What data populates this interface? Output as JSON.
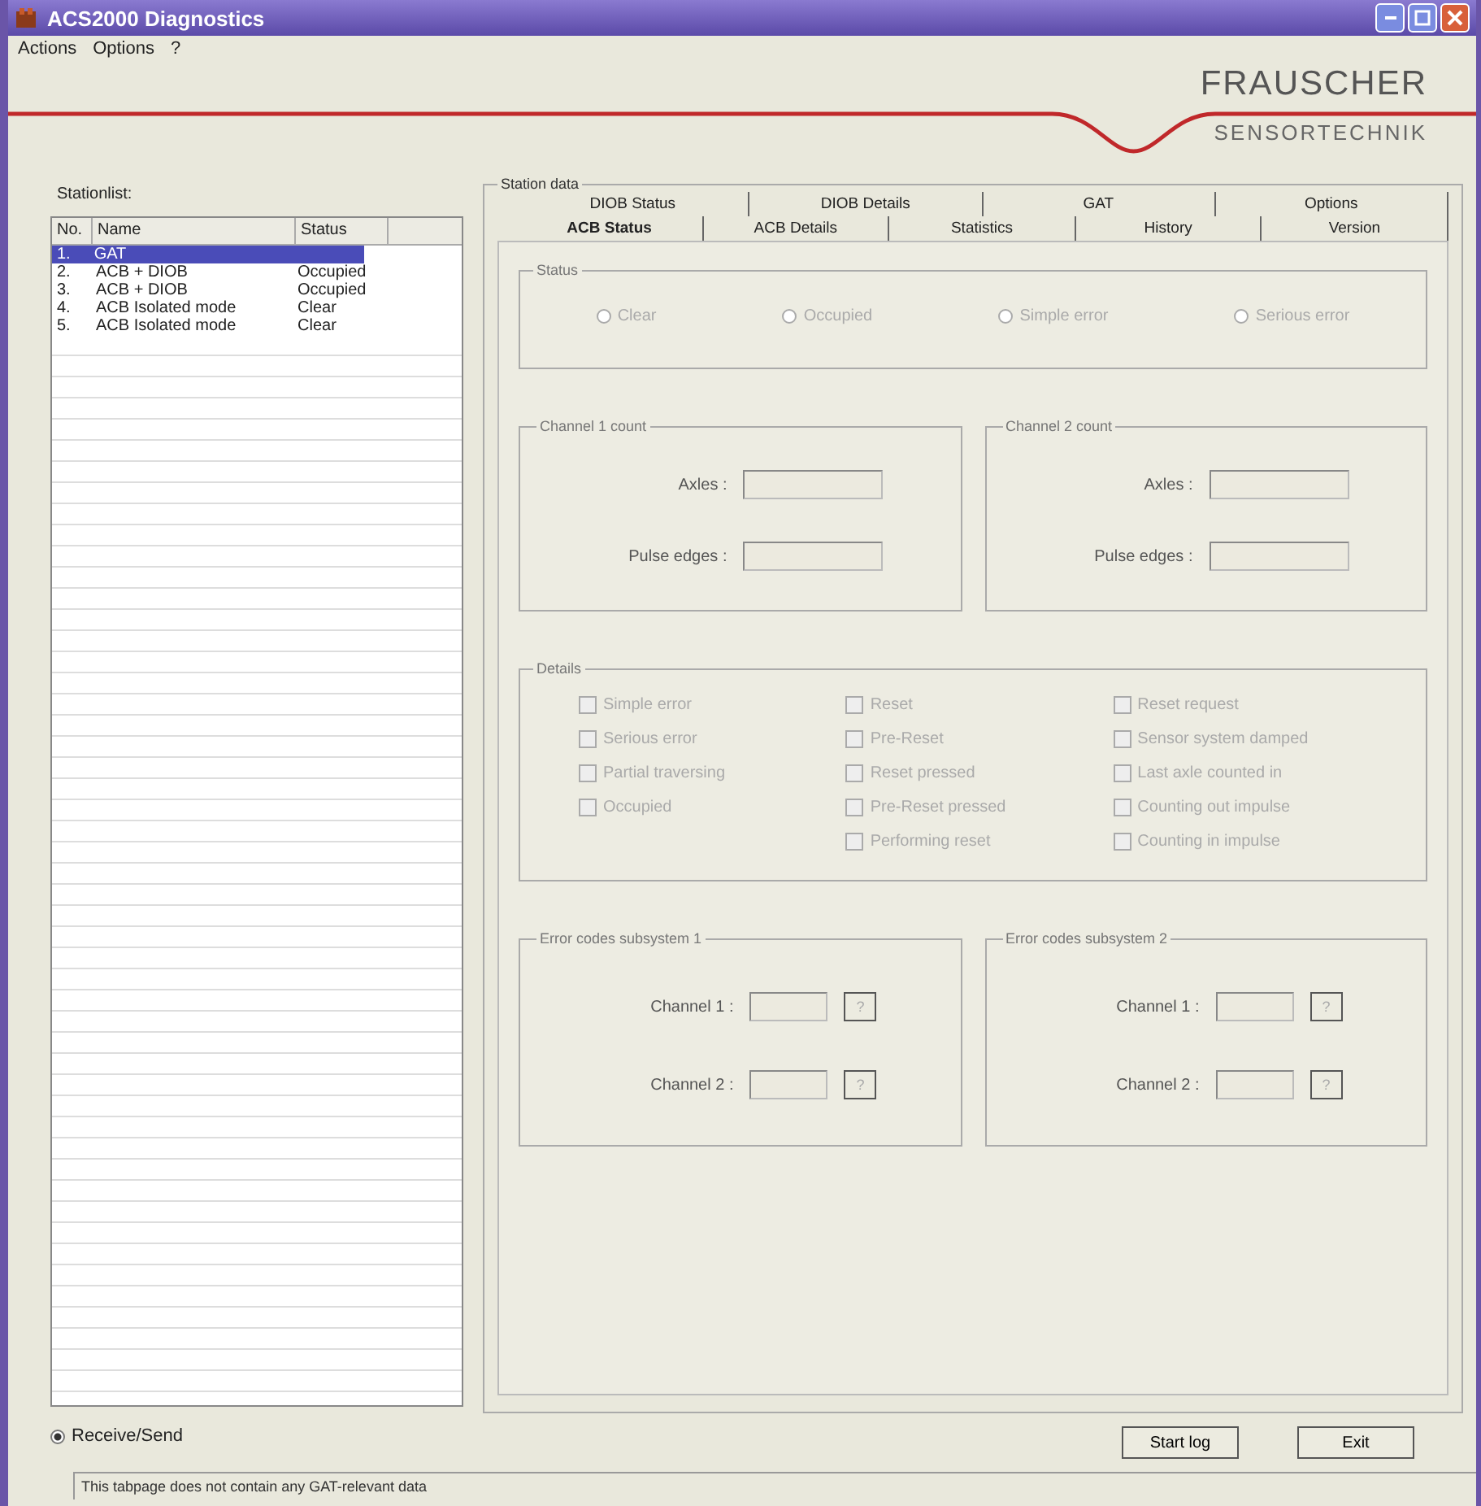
{
  "window": {
    "title": "ACS2000 Diagnostics"
  },
  "menu": [
    "Actions",
    "Options",
    "?"
  ],
  "logo": {
    "line1": "FRAUSCHER",
    "line2": "SENSORTECHNIK"
  },
  "stationlist": {
    "label": "Stationlist:",
    "columns": [
      "No.",
      "Name",
      "Status"
    ],
    "rows": [
      {
        "no": "1.",
        "name": "GAT",
        "status": "",
        "selected": true
      },
      {
        "no": "2.",
        "name": "ACB + DIOB",
        "status": "Occupied",
        "selected": false
      },
      {
        "no": "3.",
        "name": "ACB + DIOB",
        "status": "Occupied",
        "selected": false
      },
      {
        "no": "4.",
        "name": "ACB Isolated mode",
        "status": "Clear",
        "selected": false
      },
      {
        "no": "5.",
        "name": "ACB Isolated mode",
        "status": "Clear",
        "selected": false
      }
    ]
  },
  "mode": {
    "label": "Receive/Send",
    "selected": true
  },
  "status_bar": "This tabpage does not contain any GAT-relevant data",
  "station_data": {
    "label": "Station data",
    "tabs_back": [
      {
        "label": "DIOB Status",
        "selected": false
      },
      {
        "label": "DIOB Details",
        "selected": false
      },
      {
        "label": "GAT",
        "selected": false
      },
      {
        "label": "Options",
        "selected": false
      }
    ],
    "tabs_front": [
      {
        "label": "ACB Status",
        "selected": true
      },
      {
        "label": "ACB Details",
        "selected": false
      },
      {
        "label": "Statistics",
        "selected": false
      },
      {
        "label": "History",
        "selected": false
      },
      {
        "label": "Version",
        "selected": false
      }
    ],
    "status": {
      "label": "Status",
      "options": [
        {
          "label": "Clear",
          "selected": false,
          "disabled": true
        },
        {
          "label": "Occupied",
          "selected": false,
          "disabled": true
        },
        {
          "label": "Simple error",
          "selected": false,
          "disabled": true
        },
        {
          "label": "Serious error",
          "selected": false,
          "disabled": true
        }
      ]
    },
    "counts": [
      {
        "label": "Channel 1 count",
        "fields": [
          {
            "label": "Axles :",
            "disabled": true
          },
          {
            "label": "Pulse edges :",
            "disabled": true
          }
        ]
      },
      {
        "label": "Channel 2 count",
        "fields": [
          {
            "label": "Axles :",
            "disabled": true
          },
          {
            "label": "Pulse edges :",
            "disabled": true
          }
        ]
      }
    ],
    "details": {
      "label": "Details",
      "columns": [
        [
          {
            "label": "Simple error",
            "checked": false,
            "disabled": true
          },
          {
            "label": "Serious error",
            "checked": false,
            "disabled": true
          },
          {
            "label": "Partial traversing",
            "checked": false,
            "disabled": true
          },
          {
            "label": "Occupied",
            "checked": false,
            "disabled": true
          }
        ],
        [
          {
            "label": "Reset",
            "checked": false,
            "disabled": true
          },
          {
            "label": "Pre-Reset",
            "checked": false,
            "disabled": true
          },
          {
            "label": "Reset pressed",
            "checked": false,
            "disabled": true
          },
          {
            "label": "Pre-Reset pressed",
            "checked": false,
            "disabled": true
          },
          {
            "label": "Performing reset",
            "checked": false,
            "disabled": true
          }
        ],
        [
          {
            "label": "Reset request",
            "checked": false,
            "disabled": true
          },
          {
            "label": "Sensor system damped",
            "checked": false,
            "disabled": true
          },
          {
            "label": "Last axle counted in",
            "checked": false,
            "disabled": true
          },
          {
            "label": "Counting out impulse",
            "checked": false,
            "disabled": true
          },
          {
            "label": "Counting in impulse",
            "checked": false,
            "disabled": true
          }
        ]
      ]
    },
    "errors": [
      {
        "label": "Error codes subsystem 1",
        "fields": [
          {
            "label": "Channel 1 :",
            "button": "?",
            "disabled": true
          },
          {
            "label": "Channel 2 :",
            "button": "?",
            "disabled": true
          }
        ]
      },
      {
        "label": "Error codes subsystem 2",
        "fields": [
          {
            "label": "Channel 1 :",
            "button": "?",
            "disabled": true
          },
          {
            "label": "Channel 2 :",
            "button": "?",
            "disabled": true
          }
        ]
      }
    ]
  },
  "buttons": [
    "Start log",
    "Exit"
  ]
}
